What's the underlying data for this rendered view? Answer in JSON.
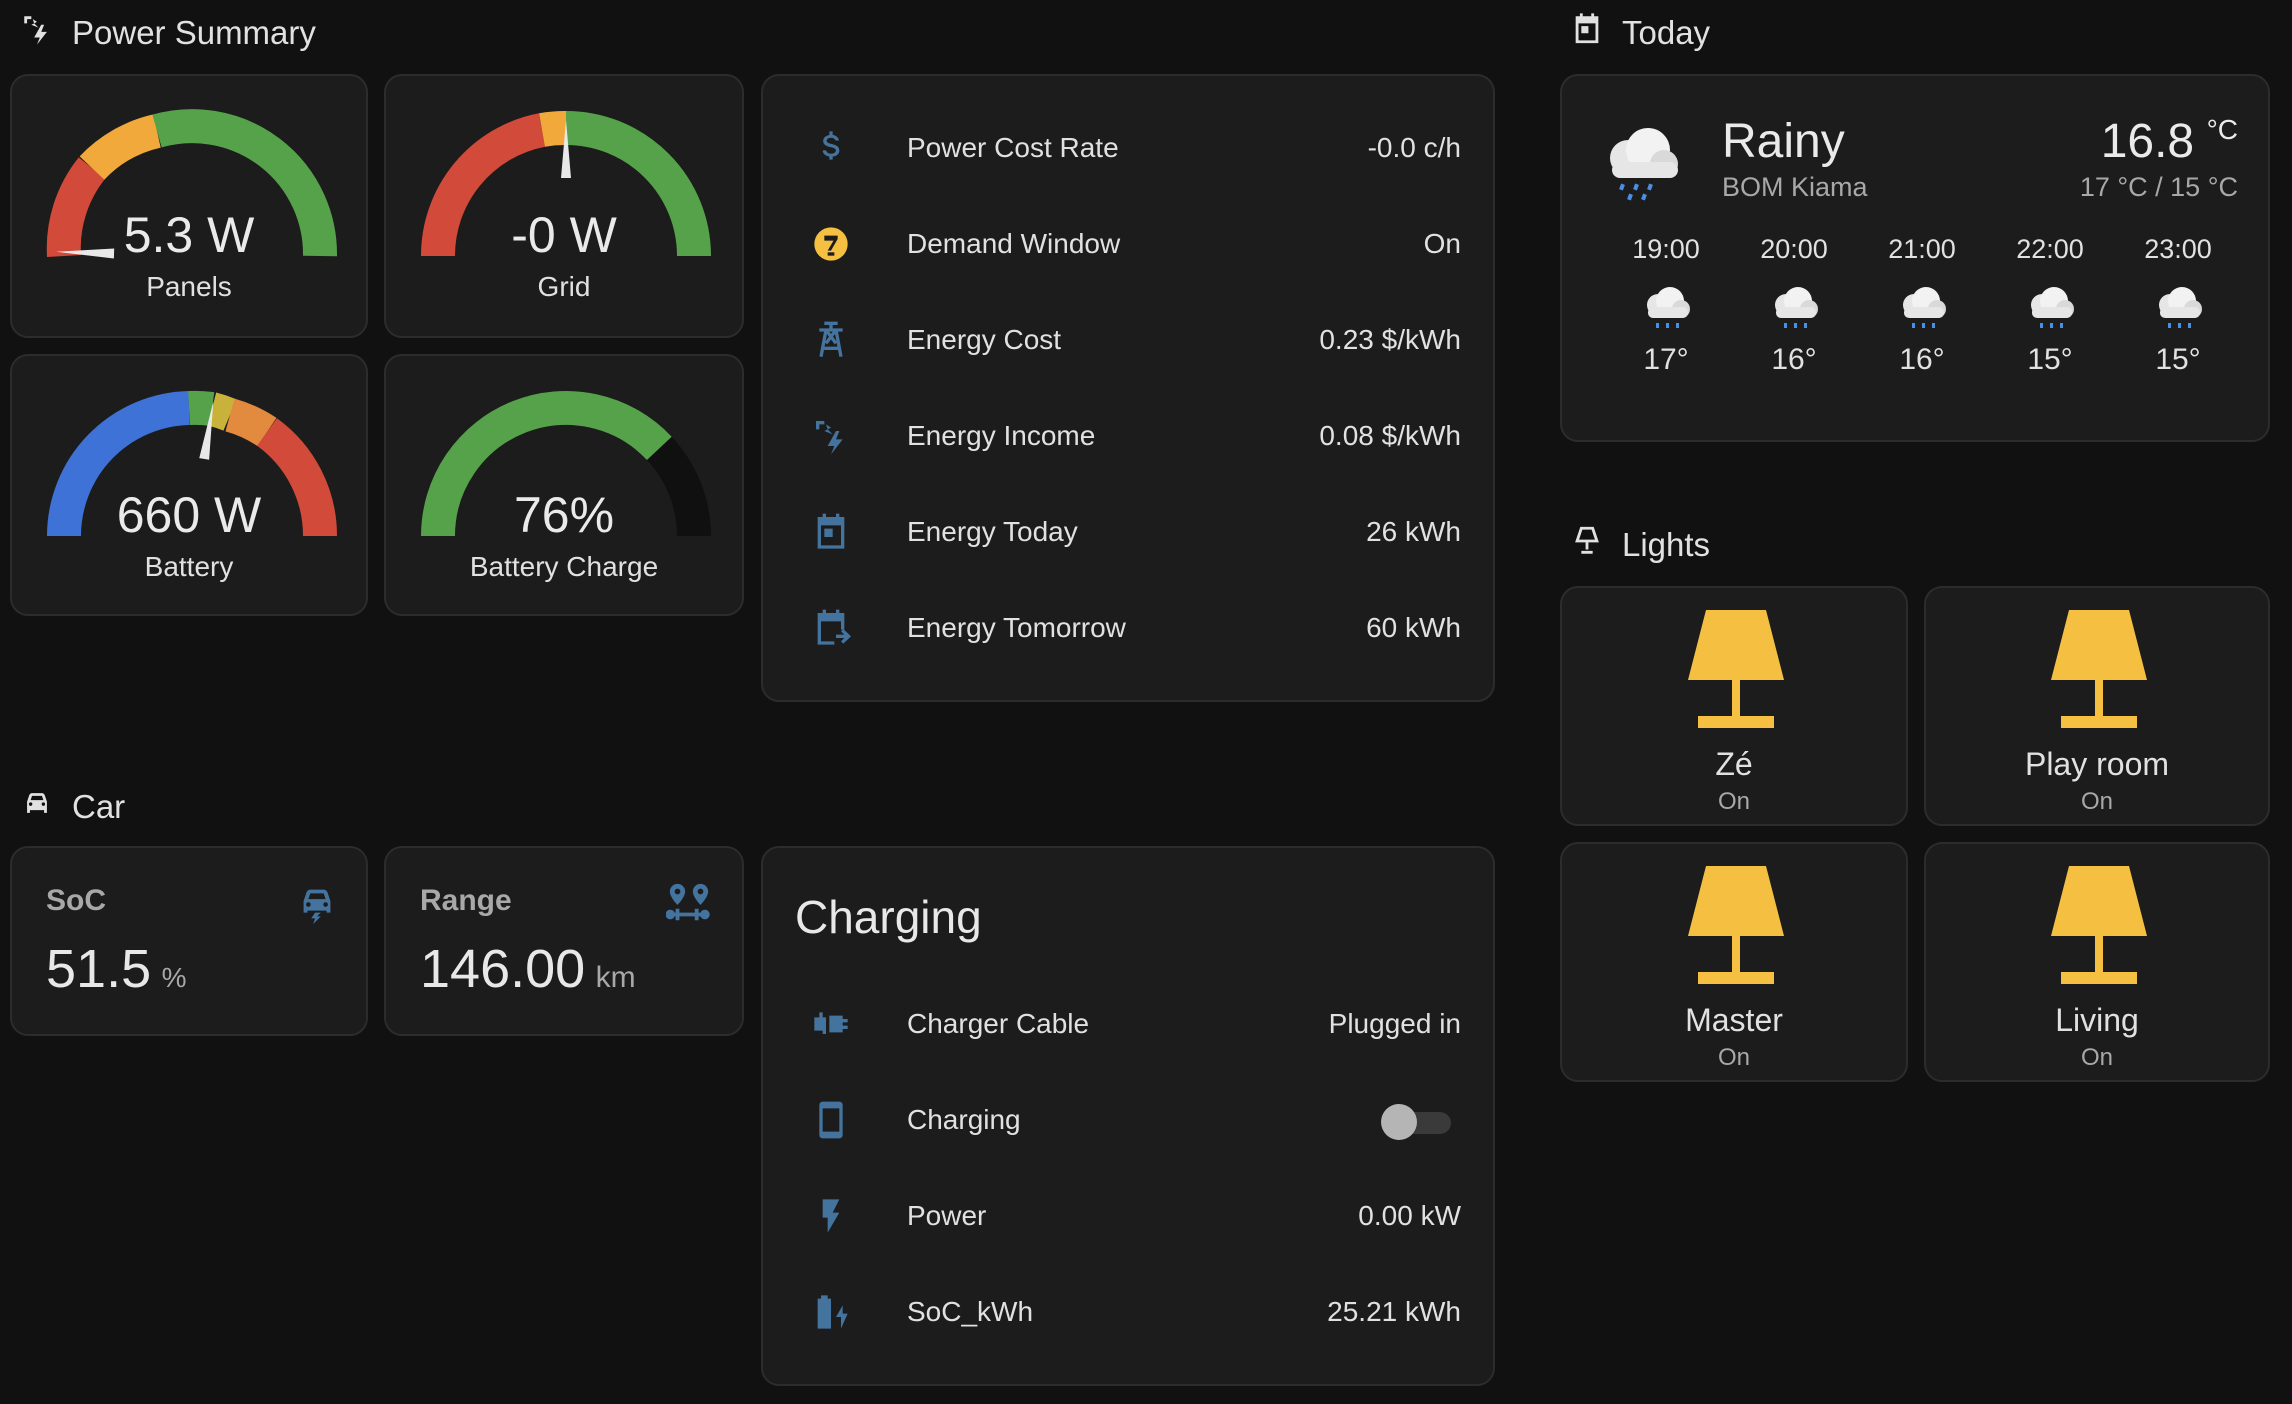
{
  "power_summary": {
    "title": "Power Summary",
    "gauges": [
      {
        "label": "Panels",
        "value": "5.3 W",
        "level": 0.01
      },
      {
        "label": "Grid",
        "value": "-0 W",
        "level": 0.5
      },
      {
        "label": "Battery",
        "value": "660 W",
        "level": 0.55
      },
      {
        "label": "Battery Charge",
        "value": "76%",
        "level": 0.76
      }
    ],
    "entities": [
      {
        "icon": "currency-usd-icon",
        "name": "Power Cost Rate",
        "value": "-0.0 c/h"
      },
      {
        "icon": "demand-window-icon",
        "name": "Demand Window",
        "value": "On"
      },
      {
        "icon": "transmission-tower-icon",
        "name": "Energy Cost",
        "value": "0.23 $/kWh"
      },
      {
        "icon": "solar-power-icon",
        "name": "Energy Income",
        "value": "0.08 $/kWh"
      },
      {
        "icon": "calendar-today-icon",
        "name": "Energy Today",
        "value": "26 kWh"
      },
      {
        "icon": "calendar-arrow-right-icon",
        "name": "Energy Tomorrow",
        "value": "60 kWh"
      }
    ]
  },
  "car": {
    "title": "Car",
    "soc": {
      "label": "SoC",
      "value": "51.5",
      "unit": "%"
    },
    "range": {
      "label": "Range",
      "value": "146.00",
      "unit": "km"
    },
    "charging": {
      "title": "Charging",
      "entities": [
        {
          "icon": "ev-plug-icon",
          "name": "Charger Cable",
          "value": "Plugged in"
        },
        {
          "icon": "cellphone-icon",
          "name": "Charging",
          "value": ""
        },
        {
          "icon": "flash-icon",
          "name": "Power",
          "value": "0.00 kW"
        },
        {
          "icon": "battery-charging-icon",
          "name": "SoC_kWh",
          "value": "25.21 kWh"
        }
      ],
      "charging_toggle_on": false
    }
  },
  "today": {
    "title": "Today",
    "condition": "Rainy",
    "source": "BOM Kiama",
    "temperature": "16.8",
    "temp_unit": "°C",
    "high_low": "17 °C / 15 °C",
    "forecast": [
      {
        "time": "19:00",
        "temp": "17°"
      },
      {
        "time": "20:00",
        "temp": "16°"
      },
      {
        "time": "21:00",
        "temp": "16°"
      },
      {
        "time": "22:00",
        "temp": "15°"
      },
      {
        "time": "23:00",
        "temp": "15°"
      }
    ]
  },
  "lights": {
    "title": "Lights",
    "items": [
      {
        "name": "Zé",
        "state": "On"
      },
      {
        "name": "Play room",
        "state": "On"
      },
      {
        "name": "Master",
        "state": "On"
      },
      {
        "name": "Living",
        "state": "On"
      }
    ]
  },
  "colors": {
    "background": "#111111",
    "card": "#1c1c1c",
    "icon_blue": "#44739e",
    "light_yellow": "#f5c042",
    "gauge_green": "#56a24a",
    "gauge_orange": "#f2a93b",
    "gauge_red": "#d14a3a",
    "gauge_blue": "#3f72d6"
  }
}
